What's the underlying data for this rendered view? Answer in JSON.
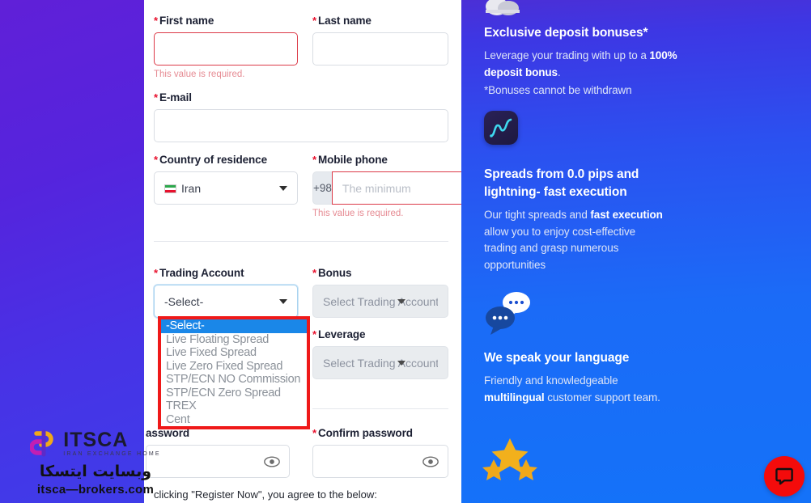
{
  "form": {
    "first_name": {
      "label": "First name",
      "required_mark": "*",
      "value": "",
      "error": "This value is required."
    },
    "last_name": {
      "label": "Last name",
      "required_mark": "*",
      "value": ""
    },
    "email": {
      "label": "E-mail",
      "required_mark": "*",
      "value": ""
    },
    "country": {
      "label": "Country of residence",
      "required_mark": "*",
      "value": "Iran",
      "flag": "iran-flag-icon"
    },
    "mobile": {
      "label": "Mobile phone",
      "required_mark": "*",
      "country_code": "+98",
      "placeholder": "The minimum",
      "value": "",
      "error": "This value is required."
    },
    "trading_account": {
      "label": "Trading Account",
      "required_mark": "*",
      "value": "-Select-",
      "options": [
        "-Select-",
        "Live Floating Spread",
        "Live Fixed Spread",
        "Live Zero Fixed Spread",
        "STP/ECN NO Commission",
        "STP/ECN Zero Spread",
        "TREX",
        "Cent"
      ],
      "selected_index": 0
    },
    "bonus": {
      "label": "Bonus",
      "required_mark": "*",
      "value": "Select Trading Account",
      "disabled": true
    },
    "leverage": {
      "label": "Leverage",
      "required_mark": "*",
      "value": "Select Trading Account",
      "disabled": true
    },
    "password": {
      "label": "assword",
      "required_mark": "",
      "value": "",
      "toggle_icon": "eye-icon"
    },
    "confirm_password": {
      "label": "Confirm password",
      "required_mark": "*",
      "value": "",
      "toggle_icon": "eye-icon"
    },
    "agreement_text": "clicking \"Register Now\", you agree to the below:"
  },
  "promo": {
    "blocks": [
      {
        "title": "Exclusive deposit bonuses*",
        "body_1": "Leverage your trading with up to a ",
        "body_bold": "100% deposit bonus",
        "body_2": ".",
        "body_3": "*Bonuses cannot be withdrawn"
      },
      {
        "title": "Spreads from 0.0 pips and lightning- fast execution",
        "body_1": "Our tight spreads and ",
        "body_bold": "fast execution",
        "body_2": " allow you to enjoy cost-effective trading and grasp numerous opportunities"
      },
      {
        "title": "We speak your language",
        "body_1": "Friendly and knowledgeable ",
        "body_bold": "multilingual",
        "body_2": " customer support team."
      }
    ],
    "icons": [
      "cloud-icon",
      "chart-line-icon",
      "chat-bubbles-icon",
      "stars-icon"
    ]
  },
  "chat_widget": {
    "icon": "chat-bubble-icon",
    "color": "#f40b0b"
  },
  "watermark": {
    "brand": "ITSCA",
    "tagline": "IRAN EXCHANGE HOME",
    "persian": "وبسایت ایتسکا",
    "url": "itsca—brokers.com"
  },
  "colors": {
    "left_panel_start": "#6020d8",
    "left_panel_end": "#3f3ce9",
    "right_panel_start": "#4b2fd6",
    "right_panel_end": "#1472f9",
    "required_red": "#e8112d",
    "error_border": "#dc3a48",
    "dropdown_highlight": "#1a87e8",
    "dropdown_outline": "#ef1919"
  }
}
